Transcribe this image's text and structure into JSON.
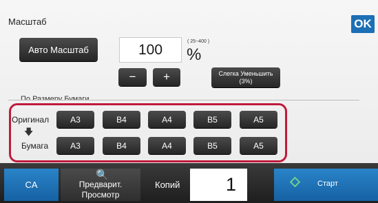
{
  "title": "Масштаб",
  "ok_label": "OK",
  "auto_scale_label": "Авто Масштаб",
  "scale_value": "100",
  "scale_range": "( 25~400 )",
  "percent_sign": "%",
  "minus_label": "−",
  "plus_label": "+",
  "reduce_label_line1": "Слегка Уменьшить",
  "reduce_label_line2": "(3%)",
  "section_label": "По Размеру Бумаги",
  "original_label": "Оригинал",
  "arrow_glyph": "🡇",
  "paper_label": "Бумага",
  "original_sizes": [
    "A3",
    "B4",
    "A4",
    "B5",
    "A5"
  ],
  "paper_sizes": [
    "A3",
    "B4",
    "A4",
    "B5",
    "A5"
  ],
  "bottom": {
    "ca_label": "CA",
    "preview_label_line1": "Предварит.",
    "preview_label_line2": "Просмотр",
    "preview_icon_glyph": "🔍",
    "copies_label": "Копий",
    "copies_value": "1",
    "start_label": "Старт"
  },
  "colors": {
    "accent_blue": "#1c6fb5",
    "highlight_red": "#c1193b",
    "button_dark": "#2f2f2f"
  }
}
